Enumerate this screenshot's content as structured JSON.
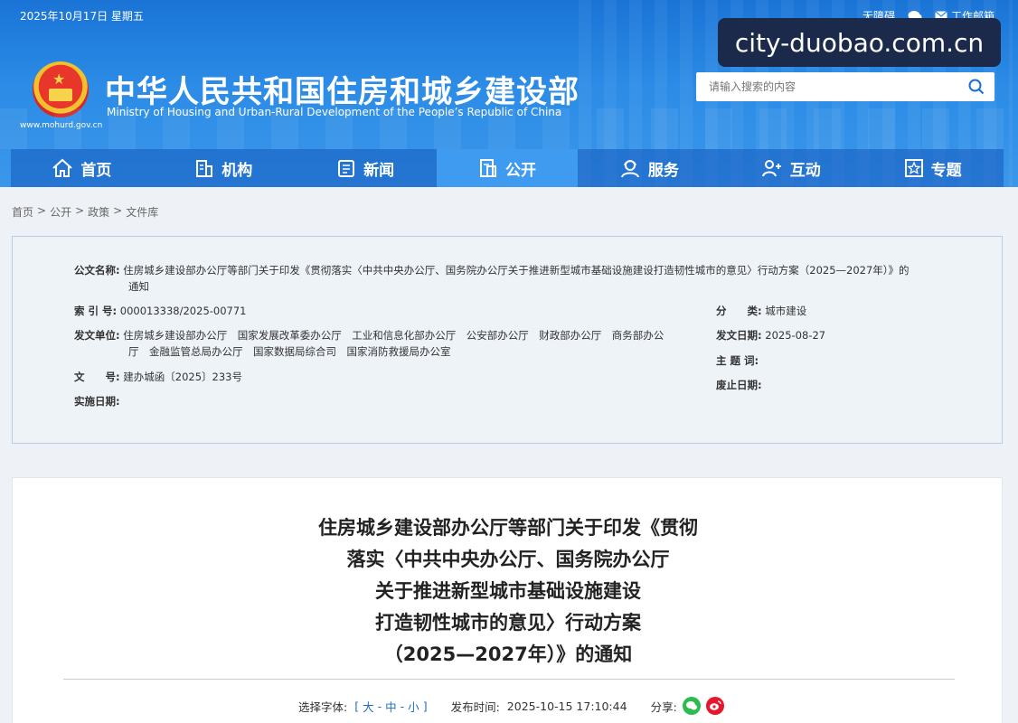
{
  "header": {
    "date": "2025年10月17日 星期五",
    "top_links": [
      "无障碍",
      "",
      "工作邮箱"
    ],
    "watermark": "city-duobao.com.cn",
    "site_url": "www.mohurd.gov.cn",
    "site_title": "中华人民共和国住房和城乡建设部",
    "site_subtitle": "Ministry of Housing and Urban-Rural Development of the People’s Republic of China",
    "search_placeholder": "请输入搜索的内容",
    "brand_color": "#1a74d6"
  },
  "nav": {
    "items": [
      {
        "label": "首页",
        "icon": "home-icon"
      },
      {
        "label": "机构",
        "icon": "building-icon"
      },
      {
        "label": "新闻",
        "icon": "news-icon"
      },
      {
        "label": "公开",
        "icon": "document-icon",
        "active": true
      },
      {
        "label": "服务",
        "icon": "person-service-icon"
      },
      {
        "label": "互动",
        "icon": "interaction-icon"
      },
      {
        "label": "专题",
        "icon": "star-icon"
      }
    ]
  },
  "breadcrumb": [
    "首页",
    "公开",
    "政策",
    "文件库"
  ],
  "meta": {
    "title_label": "公文名称:",
    "title_value_line1": "住房城乡建设部办公厅等部门关于印发《贯彻落实〈中共中央办公厅、国务院办公厅关于推进新型城市基础设施建设打造韧性城市的意见〉行动方案（2025—2027年）》的",
    "title_value_line2": "通知",
    "index_label": "索 引 号:",
    "index_value": "000013338/2025-00771",
    "category_label": "分　　类:",
    "category_value": "城市建设",
    "issuer_label": "发文单位:",
    "issuer_value_line1": "住房城乡建设部办公厅　国家发展改革委办公厅　工业和信息化部办公厅　公安部办公厅　财政部办公厅　商务部办公",
    "issuer_value_line2": "厅　金融监管总局办公厅　国家数据局综合司　国家消防救援局办公室",
    "issue_date_label": "发文日期:",
    "issue_date_value": "2025-08-27",
    "keywords_label": "主 题 词:",
    "keywords_value": "",
    "doc_no_label": "文　　号:",
    "doc_no_value": "建办城函〔2025〕233号",
    "abolish_label": "废止日期:",
    "abolish_value": "",
    "effective_label": "实施日期:",
    "effective_value": ""
  },
  "article": {
    "title_lines": [
      "住房城乡建设部办公厅等部门关于印发《贯彻",
      "落实〈中共中央办公厅、国务院办公厅",
      "关于推进新型城市基础设施建设",
      "打造韧性城市的意见〉行动方案",
      "（2025—2027年）》的通知"
    ],
    "font_select_label": "选择字体:",
    "font_bracket_open": "[",
    "font_large": "大",
    "font_medium": "中",
    "font_small": "小",
    "font_bracket_close": "]",
    "font_sep": "-",
    "publish_label": "发布时间:",
    "publish_value": "2025-10-15 17:10:44",
    "share_label": "分享:"
  }
}
